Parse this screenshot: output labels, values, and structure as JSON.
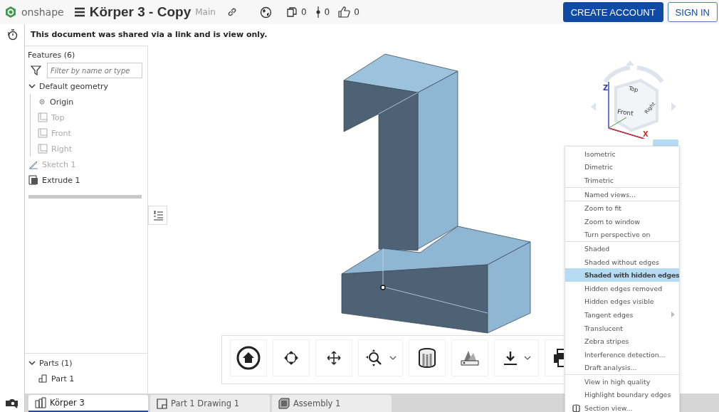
{
  "header": {
    "logo_text": "onshape",
    "title": "Körper 3 - Copy",
    "branch": "Main",
    "counters": [
      {
        "kind": "copies",
        "value": "0"
      },
      {
        "kind": "versions",
        "value": "0"
      },
      {
        "kind": "likes",
        "value": "0"
      }
    ],
    "buttons": [
      {
        "label": "CREATE ACCOUNT",
        "kind": "primary"
      },
      {
        "label": "SIGN IN",
        "kind": "secondary"
      }
    ]
  },
  "notice": "This document was shared via a link and is view only.",
  "features": {
    "title": "Features (6)",
    "filter": {
      "placeholder": "Filter by name or type"
    },
    "tree": [
      {
        "label": "Default geometry",
        "kind": "group",
        "expanded": true,
        "dimmed": false,
        "children": [
          {
            "label": "Origin",
            "kind": "origin",
            "dimmed": false
          },
          {
            "label": "Top",
            "kind": "plane",
            "dimmed": true
          },
          {
            "label": "Front",
            "kind": "plane",
            "dimmed": true
          },
          {
            "label": "Right",
            "kind": "plane",
            "dimmed": true
          }
        ]
      },
      {
        "label": "Sketch 1",
        "kind": "sketch",
        "dimmed": true
      },
      {
        "label": "Extrude 1",
        "kind": "extrude",
        "dimmed": false
      }
    ]
  },
  "parts": {
    "title": "Parts (1)",
    "expanded": true,
    "items": [
      "Part 1"
    ]
  },
  "view_cube": {
    "faces": [
      "Front",
      "Right",
      "Top"
    ],
    "axes": [
      "Z",
      "X"
    ]
  },
  "toolbar": [
    {
      "kind": "home",
      "dropdown": false
    },
    {
      "kind": "rotate",
      "dropdown": false
    },
    {
      "kind": "pan",
      "dropdown": false
    },
    {
      "kind": "zoom",
      "dropdown": true
    },
    {
      "kind": "view",
      "dropdown": false
    },
    {
      "kind": "appearance",
      "dropdown": false
    },
    {
      "kind": "export",
      "dropdown": true
    },
    {
      "kind": "print",
      "dropdown": false
    }
  ],
  "menu": [
    [
      {
        "label": "Isometric",
        "selected": false,
        "submenu": false,
        "kind": "plain"
      },
      {
        "label": "Dimetric",
        "selected": false,
        "submenu": false,
        "kind": "plain"
      },
      {
        "label": "Trimetric",
        "selected": false,
        "submenu": false,
        "kind": "plain"
      }
    ],
    [
      {
        "label": "Named views...",
        "selected": false,
        "submenu": false,
        "kind": "plain"
      }
    ],
    [
      {
        "label": "Zoom to fit",
        "selected": false,
        "submenu": false,
        "kind": "plain"
      },
      {
        "label": "Zoom to window",
        "selected": false,
        "submenu": false,
        "kind": "plain"
      },
      {
        "label": "Turn perspective on",
        "selected": false,
        "submenu": false,
        "kind": "plain"
      }
    ],
    [
      {
        "label": "Shaded",
        "selected": false,
        "submenu": false,
        "kind": "plain"
      },
      {
        "label": "Shaded without edges",
        "selected": false,
        "submenu": false,
        "kind": "plain"
      },
      {
        "label": "Shaded with hidden edges",
        "selected": true,
        "submenu": false,
        "kind": "plain"
      },
      {
        "label": "Hidden edges removed",
        "selected": false,
        "submenu": false,
        "kind": "plain"
      },
      {
        "label": "Hidden edges visible",
        "selected": false,
        "submenu": false,
        "kind": "plain"
      },
      {
        "label": "Tangent edges",
        "selected": false,
        "submenu": true,
        "kind": "plain"
      },
      {
        "label": "Translucent",
        "selected": false,
        "submenu": false,
        "kind": "plain"
      },
      {
        "label": "Zebra stripes",
        "selected": false,
        "submenu": false,
        "kind": "plain"
      },
      {
        "label": "Interference detection...",
        "selected": false,
        "submenu": false,
        "kind": "plain"
      },
      {
        "label": "Draft analysis...",
        "selected": false,
        "submenu": false,
        "kind": "plain"
      }
    ],
    [
      {
        "label": "View in high quality",
        "selected": false,
        "submenu": false,
        "kind": "plain"
      },
      {
        "label": "Highlight boundary edges",
        "selected": false,
        "submenu": false,
        "kind": "plain"
      },
      {
        "label": "Section view...",
        "selected": false,
        "submenu": false,
        "kind": "section"
      }
    ]
  ],
  "tabs": [
    {
      "label": "Körper 3",
      "kind": "partstudio",
      "selected": true
    },
    {
      "label": "Part 1 Drawing 1",
      "kind": "drawing",
      "selected": false
    },
    {
      "label": "Assembly 1",
      "kind": "assembly",
      "selected": false
    }
  ]
}
